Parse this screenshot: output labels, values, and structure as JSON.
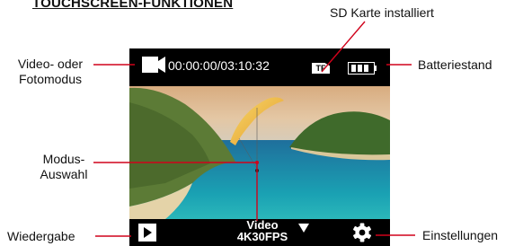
{
  "page_title": "TOUCHSCREEN-FUNKTIONEN",
  "labels": {
    "sd_card": "SD Karte installiert",
    "video_photo_line1": "Video- oder",
    "video_photo_line2": "Fotomodus",
    "battery": "Batteriestand",
    "mode_line1": "Modus-",
    "mode_line2": "Auswahl",
    "playback": "Wiedergabe",
    "settings": "Einstellungen"
  },
  "screen": {
    "timecode": "00:00:00/03:10:32",
    "sd_badge": "TF",
    "mode_name": "Video",
    "mode_resolution": "4K30FPS"
  },
  "icons": {
    "mode": "video-camera-icon",
    "sd": "sd-card-icon",
    "battery": "battery-icon",
    "playback": "play-icon",
    "dropdown": "triangle-down-icon",
    "settings": "gear-icon"
  },
  "colors": {
    "bars": "#000000",
    "overlay_text": "#ffffff",
    "callout_line": "#d0021b"
  }
}
